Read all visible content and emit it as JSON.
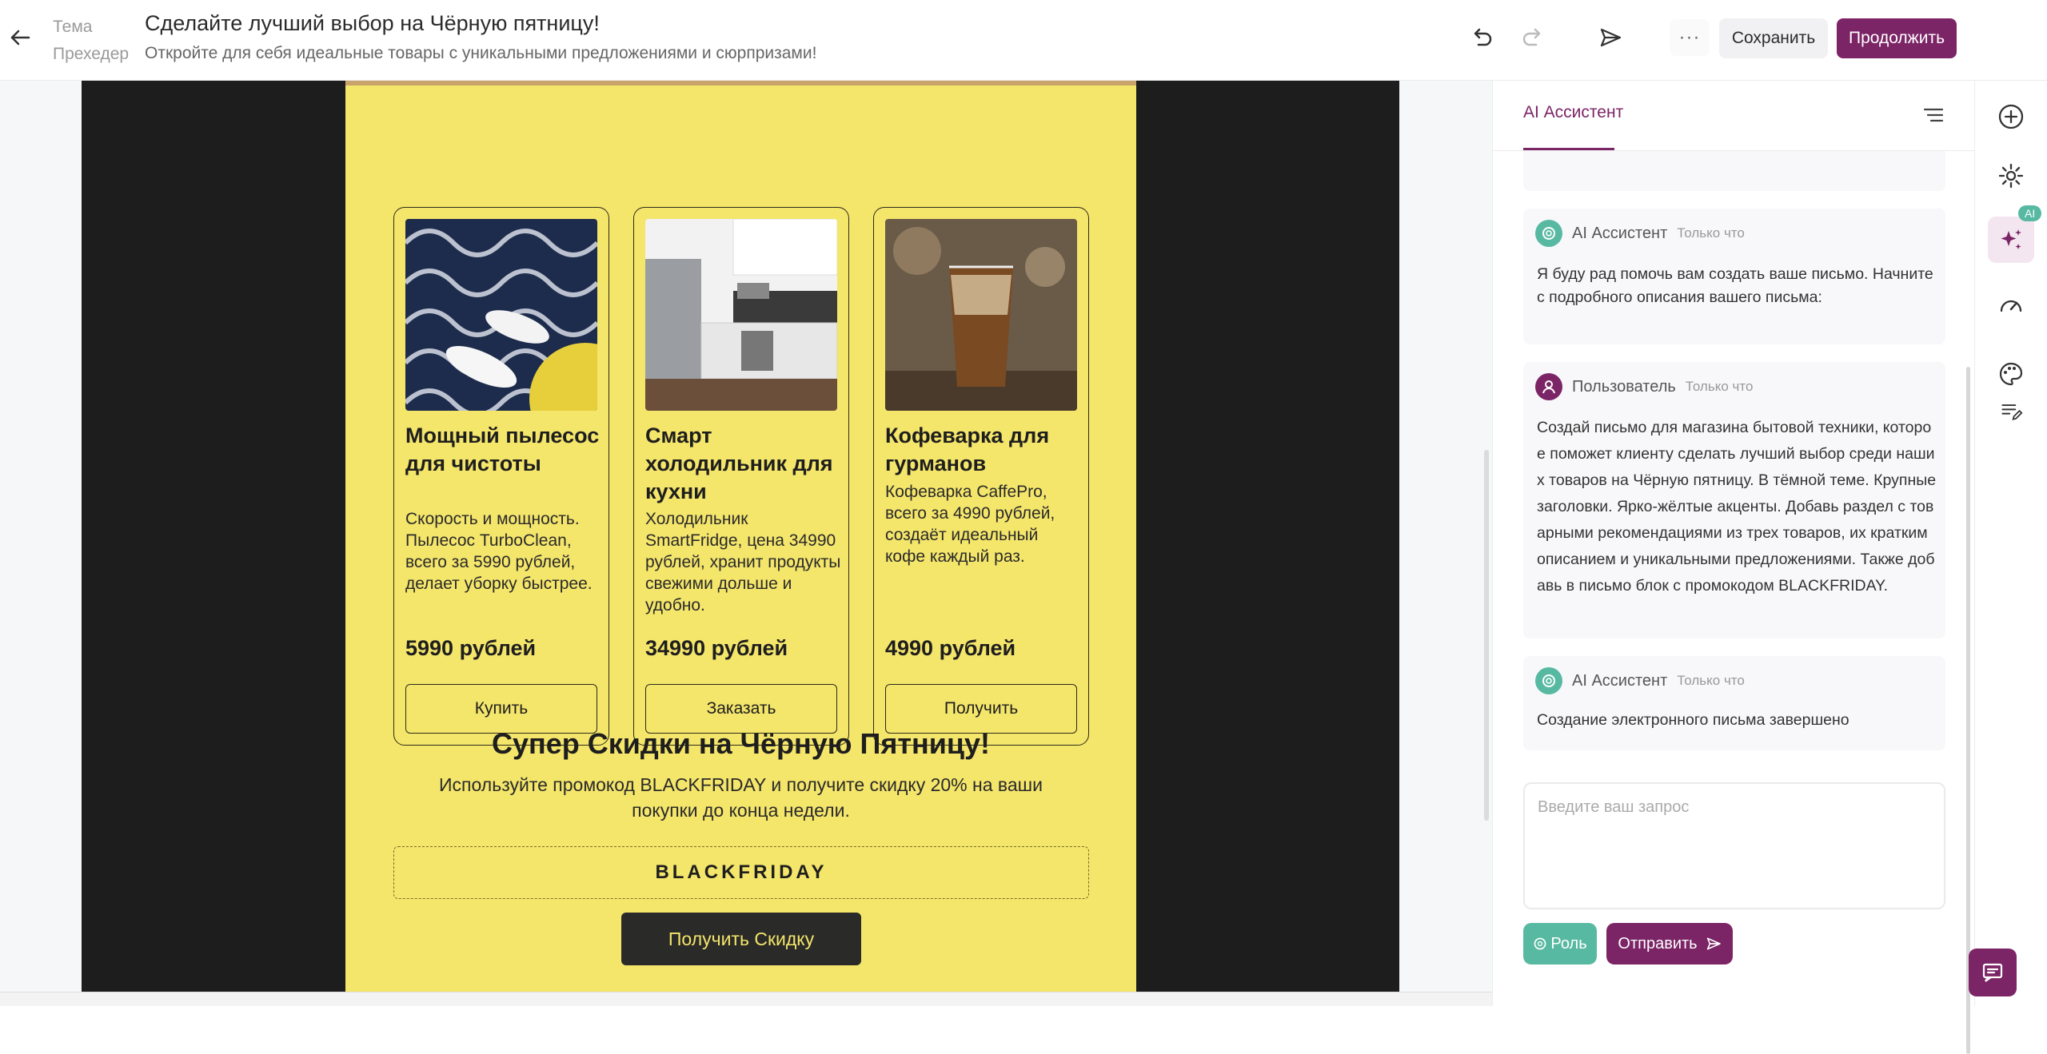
{
  "header": {
    "labels": {
      "theme": "Тема",
      "preheader": "Прехедер"
    },
    "subject": "Сделайте лучший выбор на Чёрную пятницу!",
    "preheader_text": "Откройте для себя идеальные товары с уникальными предложениями и сюрпризами!",
    "more_label": "···",
    "save_label": "Сохранить",
    "continue_label": "Продолжить"
  },
  "email": {
    "products": [
      {
        "title": "Мощный пылесос для чистоты",
        "desc": "Скорость и мощность. Пылесос TurboClean, всего за 5990 рублей, делает уборку быстрее.",
        "price": "5990 рублей",
        "button": "Купить"
      },
      {
        "title": "Смарт холодильник для кухни",
        "desc": "Холодильник SmartFridge, цена 34990 рублей, хранит продукты свежими дольше и удобно.",
        "price": "34990 рублей",
        "button": "Заказать"
      },
      {
        "title": "Кофеварка для гурманов",
        "desc": "Кофеварка CaffePro, всего за 4990 рублей, создаёт идеальный кофе каждый раз.",
        "price": "4990 рублей",
        "button": "Получить"
      }
    ],
    "promo": {
      "title": "Супер Скидки на Чёрную Пятницу!",
      "text": "Используйте промокод BLACKFRIDAY и получите скидку 20% на ваши покупки до конца недели.",
      "code": "BLACKFRIDAY",
      "button": "Получить Скидку"
    }
  },
  "panel": {
    "tab": "AI Ассистент",
    "messages": [
      {
        "author": "AI Ассистент",
        "time": "Только что",
        "text": "Я буду рад помочь вам создать ваше письмо. Начните с подробного описания вашего письма:"
      },
      {
        "author": "Пользователь",
        "time": "Только что",
        "text": "Создай письмо для магазина бытовой техники, которое поможет клиенту сделать лучший выбор среди наших товаров на Чёрную пятницу. В тёмной теме. Крупные заголовки. Ярко-жёлтые акценты. Добавь раздел с товарными рекомендациями из трех товаров, их кратким описанием и уникальными предложениями. Также добавь в письмо блок с промокодом BLACKFRIDAY."
      },
      {
        "author": "AI Ассистент",
        "time": "Только что",
        "text": "Создание электронного письма завершено"
      }
    ],
    "input_placeholder": "Введите ваш запрос",
    "role_label": "Роль",
    "send_label": "Отправить"
  },
  "rail": {
    "ai_badge": "AI"
  },
  "colors": {
    "brand": "#7b2466",
    "accent_yellow": "#f4e56b",
    "teal": "#58b9a2",
    "dark": "#1d1d1d"
  },
  "icons": [
    "back-arrow-icon",
    "undo-icon",
    "redo-icon",
    "send-test-icon",
    "plus-icon",
    "gear-icon",
    "sparkles-icon",
    "gauge-icon",
    "palette-icon",
    "notes-icon",
    "chat-icon",
    "openai-icon",
    "user-icon",
    "menu-icon"
  ]
}
